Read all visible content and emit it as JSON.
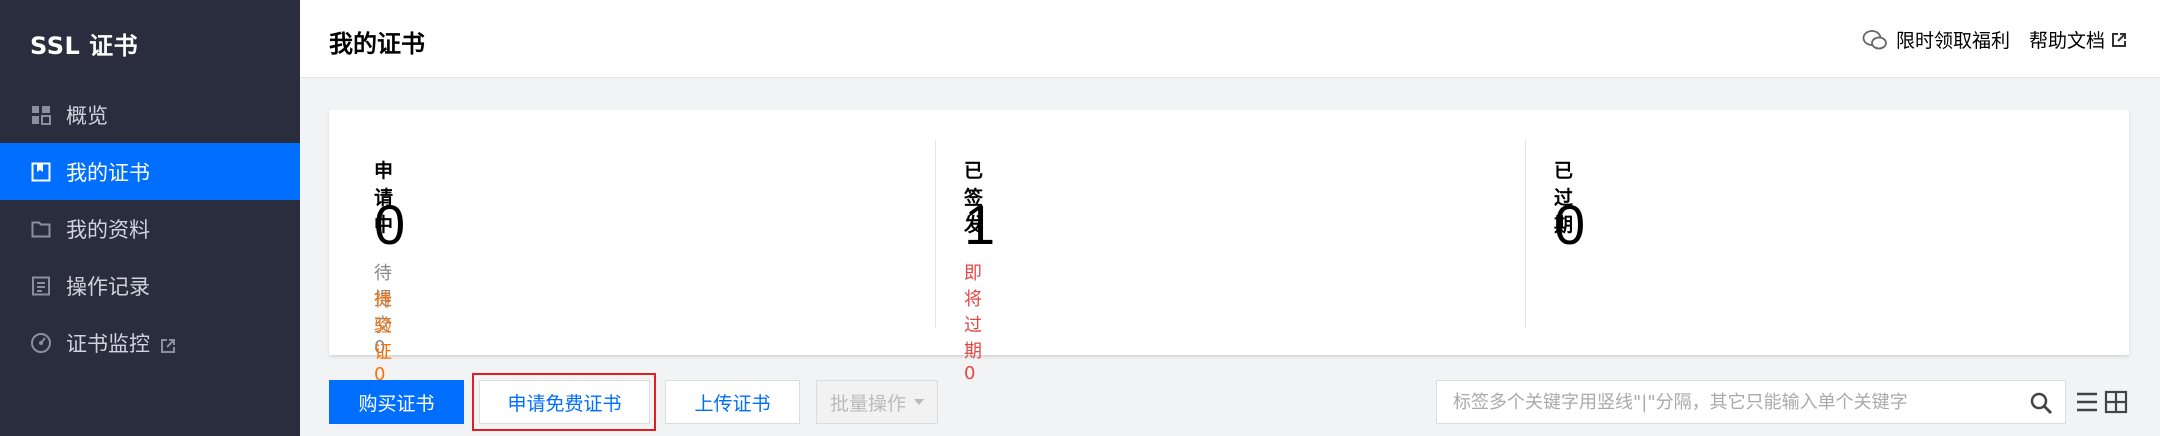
{
  "sidebar": {
    "title": "SSL 证书",
    "items": [
      {
        "label": "概览",
        "icon": "grid-icon"
      },
      {
        "label": "我的证书",
        "icon": "certificate-icon",
        "active": true
      },
      {
        "label": "我的资料",
        "icon": "folder-icon"
      },
      {
        "label": "操作记录",
        "icon": "log-icon"
      },
      {
        "label": "证书监控",
        "icon": "monitor-icon",
        "external": true
      }
    ]
  },
  "header": {
    "title": "我的证书",
    "welfare_link": "限时领取福利",
    "help_link": "帮助文档"
  },
  "stats": {
    "applying": {
      "label": "申请中",
      "value": "0",
      "pending_submit": "待提交 0",
      "pending_verify": "待验证 0"
    },
    "issued": {
      "label": "已签发",
      "value": "1",
      "expiring": "即将过期 0"
    },
    "expired": {
      "label": "已过期",
      "value": "0"
    }
  },
  "toolbar": {
    "buy_label": "购买证书",
    "free_label": "申请免费证书",
    "upload_label": "上传证书",
    "batch_label": "批量操作",
    "search_placeholder": "标签多个关键字用竖线\"|\"分隔，其它只能输入单个关键字"
  },
  "colors": {
    "accent": "#006eff",
    "sidebar_bg": "#292d3e",
    "warning": "#ff7200",
    "danger": "#e54545",
    "highlight_border": "#e02020"
  }
}
